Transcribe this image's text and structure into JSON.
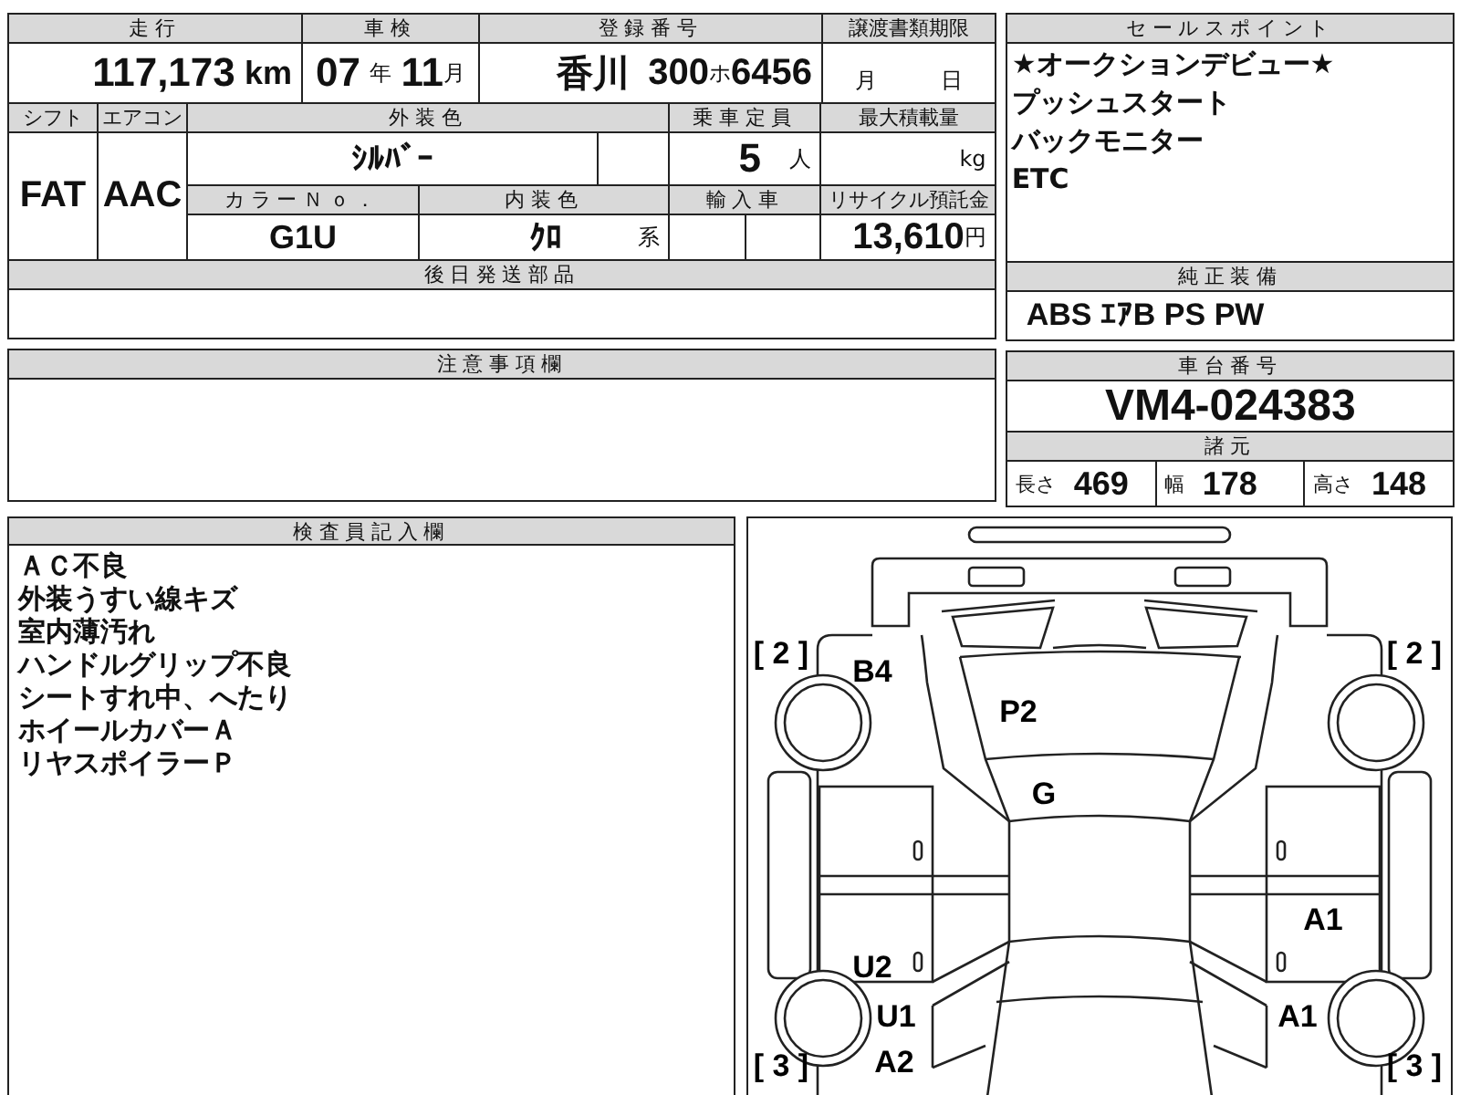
{
  "mileage": {
    "label": "走行",
    "value": "117,173",
    "unit": "km"
  },
  "inspection": {
    "label": "車検",
    "year": "07",
    "year_unit": "年",
    "month": "11",
    "month_unit": "月"
  },
  "registration": {
    "label": "登録番号",
    "region": "香川",
    "class_number": "300",
    "kana": "ホ",
    "serial": "6456"
  },
  "transfer_deadline": {
    "label": "譲渡書類期限",
    "month_unit": "月",
    "day_unit": "日"
  },
  "shift": {
    "label": "シフト",
    "value": "FAT"
  },
  "aircon": {
    "label": "エアコン",
    "value": "AAC"
  },
  "exterior_color": {
    "label": "外装色",
    "value": "ｼﾙﾊﾞｰ"
  },
  "capacity": {
    "label": "乗車定員",
    "value": "5",
    "unit": "人"
  },
  "max_load": {
    "label": "最大積載量",
    "unit": "kg"
  },
  "color_no": {
    "label": "カラーＮｏ．",
    "value": "G1U"
  },
  "interior_color": {
    "label": "内装色",
    "value": "ｸﾛ",
    "suffix": "系"
  },
  "imported": {
    "label": "輸入車"
  },
  "recycle_fee": {
    "label": "リサイクル預託金",
    "value": "13,610",
    "unit": "円"
  },
  "later_parts": {
    "label": "後日発送部品"
  },
  "notes": {
    "label": "注意事項欄"
  },
  "sales_points": {
    "label": "セールスポイント",
    "lines": [
      "★オークションデビュー★",
      "プッシュスタート",
      "バックモニター",
      "ETC"
    ]
  },
  "standard_equipment": {
    "label": "純正装備",
    "value": "ABS ｴｱB PS PW"
  },
  "chassis_number": {
    "label": "車台番号",
    "value": "VM4-024383"
  },
  "specs": {
    "label": "諸元",
    "items": [
      {
        "label": "長さ",
        "value": "469"
      },
      {
        "label": "幅",
        "value": "178"
      },
      {
        "label": "高さ",
        "value": "148"
      }
    ]
  },
  "inspector_notes": {
    "label": "検査員記入欄",
    "lines": [
      "ＡＣ不良",
      "外装うすい線キズ",
      "室内薄汚れ",
      "ハンドルグリップ不良",
      "シートすれ中、へたり",
      "ホイールカバーＡ",
      "リヤスポイラーＰ"
    ]
  },
  "damage_map": {
    "marks": [
      {
        "label": "[ 2 ]"
      },
      {
        "label": "[ 2 ]"
      },
      {
        "label": "B4"
      },
      {
        "label": "P2"
      },
      {
        "label": "G"
      },
      {
        "label": "A1"
      },
      {
        "label": "U2"
      },
      {
        "label": "U1"
      },
      {
        "label": "A1"
      },
      {
        "label": "[ 3 ]"
      },
      {
        "label": "A2"
      },
      {
        "label": "[ 3 ]"
      }
    ]
  }
}
